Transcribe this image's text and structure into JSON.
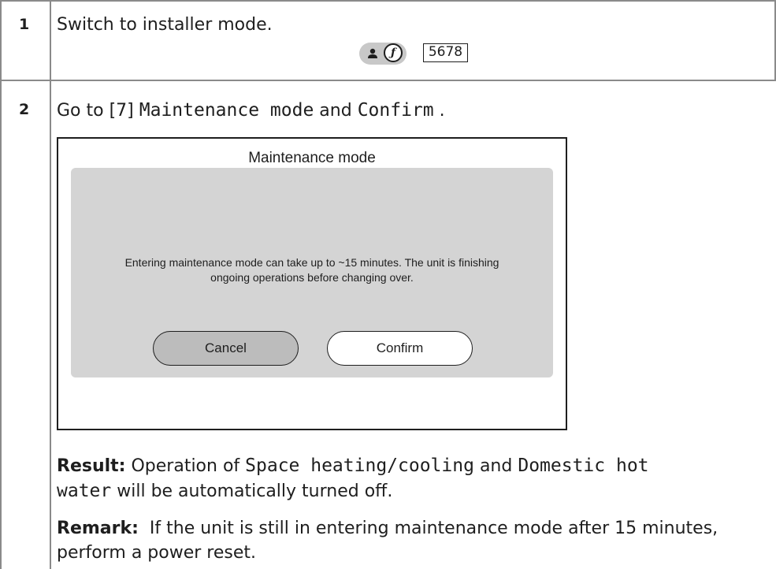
{
  "steps": [
    {
      "number": "1",
      "text": "Switch to installer mode.",
      "code": "5678"
    },
    {
      "number": "2",
      "instruction": {
        "prefix": "Go to [7] ",
        "menu": "Maintenance mode",
        "middle": " and ",
        "action": "Confirm",
        "suffix": " ."
      },
      "screen": {
        "title": "Maintenance mode",
        "message_line1": "Entering maintenance mode can take up to ~15 minutes. The unit is finishing",
        "message_line2": "ongoing operations before changing over.",
        "cancel_label": "Cancel",
        "confirm_label": "Confirm"
      },
      "result": {
        "label": "Result:",
        "part1": " Operation of ",
        "item1": "Space heating/cooling",
        "part2": " and ",
        "item2a": "Domestic hot",
        "item2b": "water",
        "part3": " will be automatically turned off."
      },
      "remark": {
        "label": "Remark:",
        "line1": "  If the unit is still in entering maintenance mode after 15 minutes,",
        "line2": "perform a power reset."
      }
    }
  ],
  "icons": {
    "user": "user-icon",
    "installer": "wrench-icon"
  },
  "colors": {
    "border": "#8a8a8a",
    "dialog_bg": "#d4d4d4",
    "cancel_bg": "#bcbcbc",
    "mode_pill": "#c8c8c8"
  }
}
